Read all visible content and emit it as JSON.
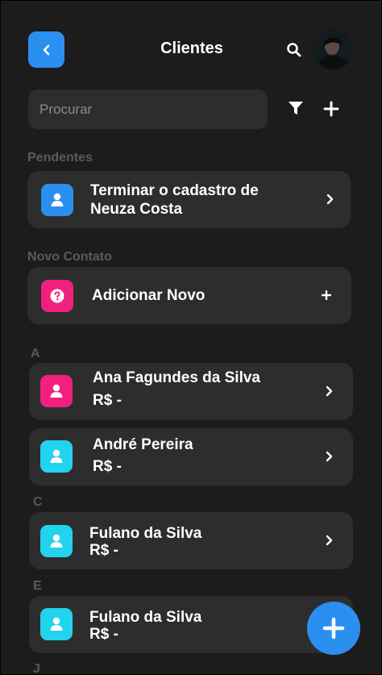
{
  "header": {
    "title": "Clientes"
  },
  "search": {
    "placeholder": "Procurar"
  },
  "sections": {
    "pending": "Pendentes",
    "new_contact": "Novo Contato",
    "a": "A",
    "c": "C",
    "e": "E",
    "j": "J"
  },
  "pending_card": {
    "line1": "Terminar o cadastro de",
    "line2": "Neuza Costa"
  },
  "new_card": {
    "label": "Adicionar Novo"
  },
  "clients": [
    {
      "name": "Ana Fagundes da Silva",
      "value": "R$ -"
    },
    {
      "name": "André Pereira",
      "value": "R$ -"
    },
    {
      "name": "Fulano da Silva",
      "value": "R$ -"
    },
    {
      "name": "Fulano da Silva",
      "value": "R$ -"
    }
  ],
  "colors": {
    "accent": "#2b8ff0",
    "pink": "#f0217d",
    "cyan": "#22d3ee",
    "card": "#2d2d2d",
    "bg": "#1c1c1c"
  }
}
